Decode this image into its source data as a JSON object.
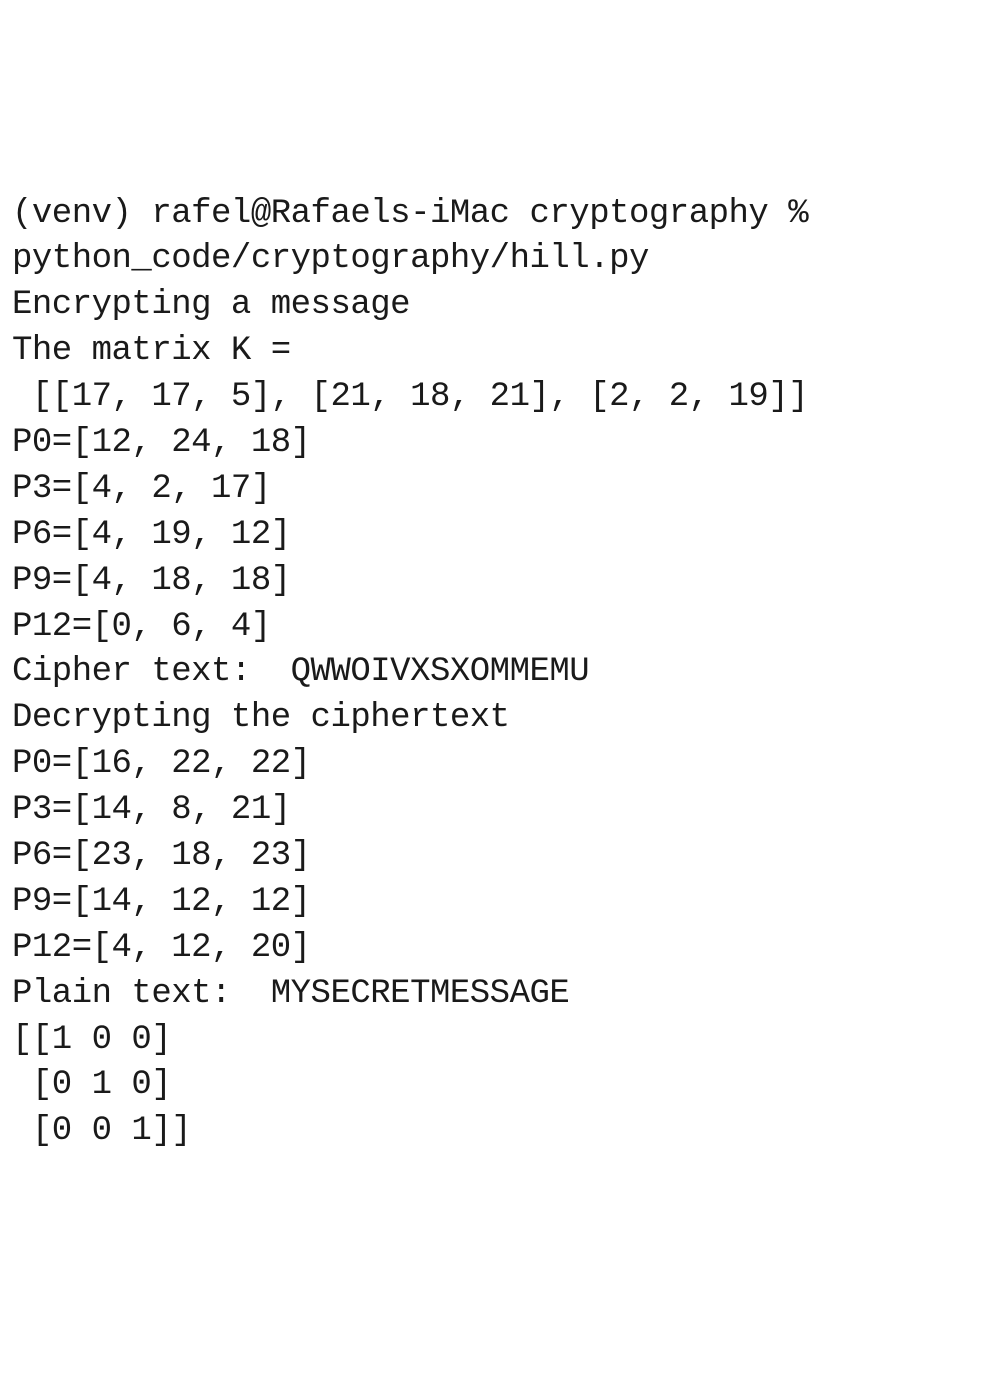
{
  "terminal": {
    "lines": [
      "(venv) rafel@Rafaels-iMac cryptography % ",
      "python_code/cryptography/hill.py",
      "Encrypting a message",
      "The matrix K =",
      " [[17, 17, 5], [21, 18, 21], [2, 2, 19]]",
      "P0=[12, 24, 18]",
      "P3=[4, 2, 17]",
      "P6=[4, 19, 12]",
      "P9=[4, 18, 18]",
      "P12=[0, 6, 4]",
      "Cipher text:  QWWOIVXSXOMMEMU",
      "Decrypting the ciphertext",
      "P0=[16, 22, 22]",
      "P3=[14, 8, 21]",
      "P6=[23, 18, 23]",
      "P9=[14, 12, 12]",
      "P12=[4, 12, 20]",
      "Plain text:  MYSECRETMESSAGE",
      "[[1 0 0]",
      " [0 1 0]",
      " [0 0 1]]"
    ]
  }
}
